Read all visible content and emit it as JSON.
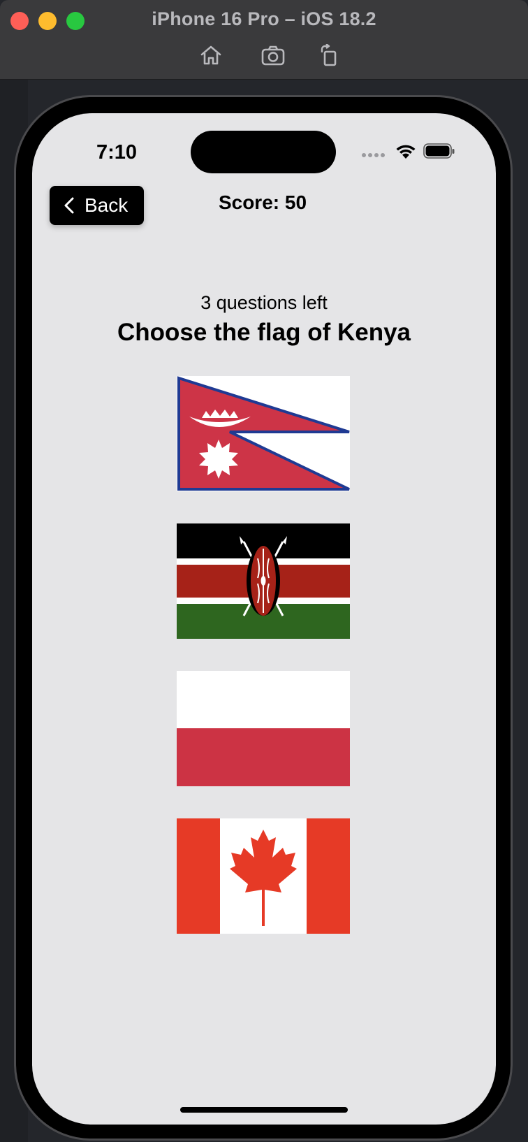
{
  "window": {
    "title": "iPhone 16 Pro – iOS 18.2",
    "toolbar": [
      "home-icon",
      "screenshot-icon",
      "rotate-icon"
    ]
  },
  "status_bar": {
    "time": "7:10"
  },
  "nav": {
    "back_label": "Back",
    "score_text": "Score: 50"
  },
  "quiz": {
    "questions_left": "3 questions left",
    "prompt": "Choose the flag of Kenya",
    "flags": [
      {
        "country_icon": "nepal-flag"
      },
      {
        "country_icon": "kenya-flag"
      },
      {
        "country_icon": "poland-flag"
      },
      {
        "country_icon": "canada-flag"
      }
    ]
  },
  "colors": {
    "screen_background": "#e5e5e7",
    "button_background": "#000000",
    "nepal_red": "#cd3447",
    "nepal_blue": "#1f3a93",
    "kenya_red": "#a62218",
    "kenya_green": "#2e661f",
    "poland_red": "#cc3344",
    "canada_red": "#e63a26"
  }
}
